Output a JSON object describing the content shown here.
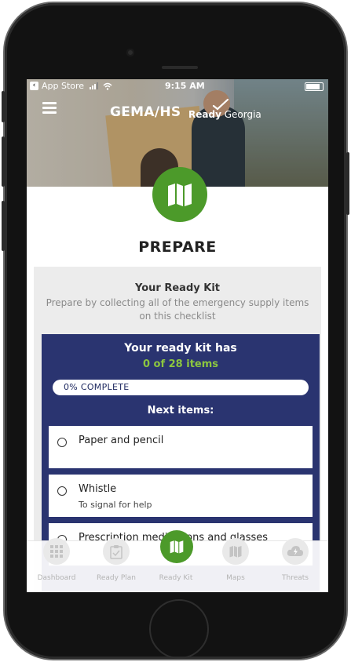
{
  "status_bar": {
    "back_app": "App Store",
    "time": "9:15 AM"
  },
  "header": {
    "brand": "GEMA/HS",
    "ready_word": "Ready",
    "georgia_word": "Georgia"
  },
  "page": {
    "title": "PREPARE"
  },
  "card": {
    "title": "Your Ready Kit",
    "subtitle": "Prepare by collecting all of the emergency supply items on this checklist"
  },
  "panel": {
    "heading": "Your ready kit has",
    "count_text": "0 of 28 items",
    "progress_percent": 0,
    "progress_label": "0% COMPLETE",
    "next_heading": "Next items:",
    "items": [
      {
        "label": "Paper and pencil",
        "desc": ""
      },
      {
        "label": "Whistle",
        "desc": "To signal for help"
      },
      {
        "label": "Prescription medications and glasses",
        "desc": ""
      }
    ]
  },
  "tabs": [
    {
      "label": "Dashboard",
      "icon": "grid-icon",
      "active": false
    },
    {
      "label": "Ready Plan",
      "icon": "clipboard-check-icon",
      "active": false
    },
    {
      "label": "Ready Kit",
      "icon": "map-icon",
      "active": true
    },
    {
      "label": "Maps",
      "icon": "map-icon",
      "active": false
    },
    {
      "label": "Threats",
      "icon": "storm-cloud-icon",
      "active": false
    }
  ],
  "colors": {
    "accent_green": "#4c9a2a",
    "count_green": "#8cc63f",
    "panel_navy": "#2a3470"
  }
}
